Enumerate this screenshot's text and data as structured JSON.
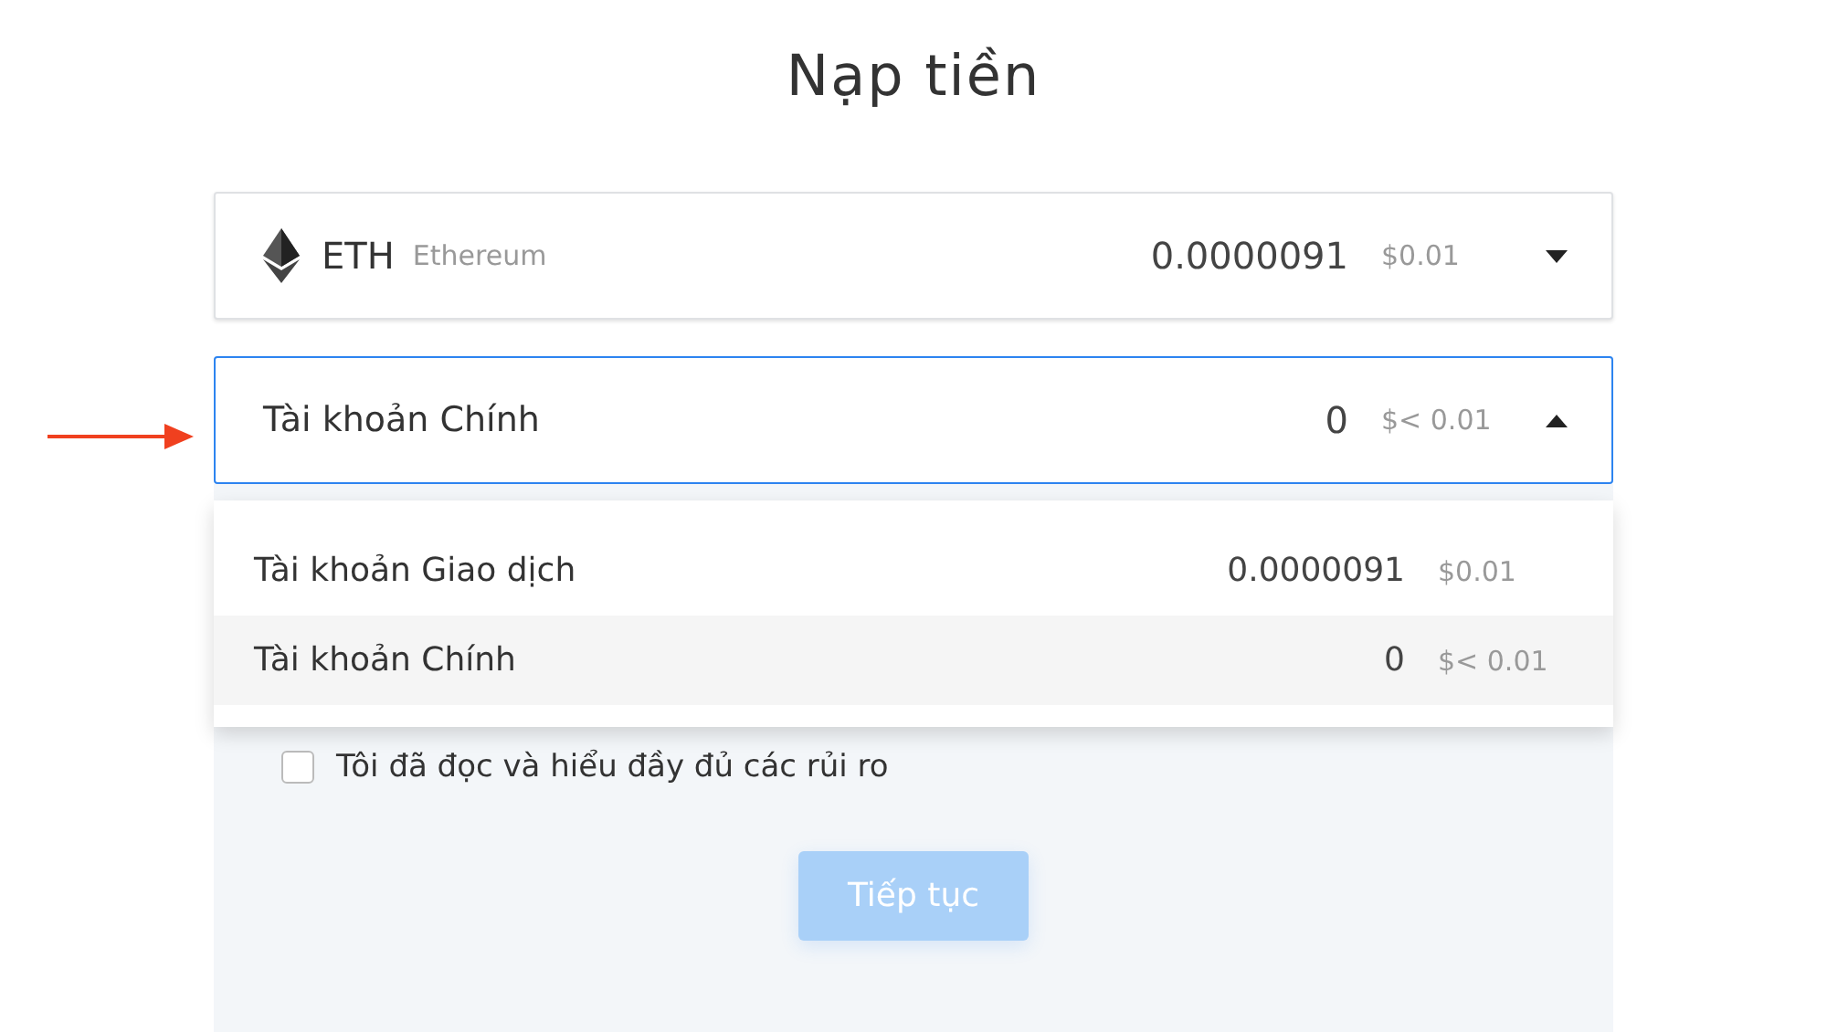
{
  "title": "Nạp tiền",
  "asset": {
    "symbol": "ETH",
    "name": "Ethereum",
    "amount": "0.0000091",
    "usd": "$0.01",
    "expanded": false
  },
  "account_select": {
    "value": "Tài khoản Chính",
    "amount": "0",
    "usd": "$< 0.01",
    "expanded": true
  },
  "options": [
    {
      "label": "Tài khoản Giao dịch",
      "amount": "0.0000091",
      "usd": "$0.01",
      "selected": false
    },
    {
      "label": "Tài khoản Chính",
      "amount": "0",
      "usd": "$< 0.01",
      "selected": true
    }
  ],
  "checkbox": {
    "label": "Tôi đã đọc và hiểu đầy đủ các rủi ro",
    "checked": false
  },
  "button": {
    "label": "Tiếp tục",
    "disabled": true
  }
}
